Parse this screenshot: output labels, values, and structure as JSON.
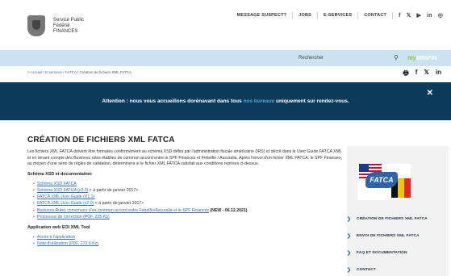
{
  "header": {
    "logo_lines": [
      "Service Public",
      "Fédéral",
      "FINANCES"
    ],
    "topnav": [
      "MESSAGE SUSPECT?",
      "JOBS",
      "E-SERVICES",
      "CONTACT"
    ],
    "social": [
      "f",
      "𝕏",
      "▶",
      "in",
      "◎"
    ]
  },
  "search": {
    "placeholder": "Rechercher",
    "myminfin_my": "my",
    "myminfin_fin": "MINFIN"
  },
  "breadcrumb": {
    "items": [
      "Accueil",
      "E-services",
      "FATCA",
      "Création de fichiers XML FATCA"
    ],
    "separator": "/"
  },
  "share": [
    "🖶",
    "f",
    "𝕏",
    "in"
  ],
  "alert": {
    "part1": "Attention : nous vous accueillons dorénavant dans tous ",
    "highlight": "nos bureaux",
    "part2": " uniquement sur rendez-vous.",
    "close": "✕"
  },
  "main": {
    "title": "CRÉATION DE FICHIERS XML FATCA",
    "intro": "Les fichiers XML FATCA doivent être formatés conformément au schéma XSD défini par l'administration fiscale américaine (IRS) et décrit dans le User Guide FATCA XML et en tenant compte des Business rules établies de commun accord entre le SPF Finances et Febelfin / Assuralia. Après l'envoi d'un fichier XML FATCA, le SPF Finances, au moyen d'une série de règles de validation, déterminera si le fichier XML FATCA satisfait aux conditions reprises ci-dessus.",
    "section1": "Schéma XSD et documentation",
    "links1": [
      {
        "link": "Schéma XSD FATCA",
        "suffix": ""
      },
      {
        "link": "Schéma XSD FATCA (v2.0)",
        "suffix": " < à partir de janvier 2017>"
      },
      {
        "link": "FATCA XML User Guide (V1.1)",
        "suffix": ""
      },
      {
        "link": "FATCA XML User Guide (v2.0)",
        "suffix": " < à partir de janvier 2017>"
      },
      {
        "link": "Business Rules convenues d'un commun accord entre Febelfin/Assuralia et le SPF Finances",
        "suffix": " ",
        "bold": "(NEW - 06.12.2021)"
      },
      {
        "link": "Processus de correction (PDF, 225 Ko)",
        "suffix": ""
      }
    ],
    "section2": "Application web EOI XML Tool",
    "links2": [
      {
        "link": "Accès à l'application",
        "suffix": ""
      },
      {
        "link": "Note d'utilisation (PDF, 273.6 Ko)",
        "suffix": ""
      }
    ]
  },
  "sidebar": {
    "image_label": "FATCA",
    "items": [
      "CRÉATION DE FICHIERS XML FATCA",
      "ENVOI DE FICHIERS XML FATCA",
      "FAQ ET DOCUMENTATION",
      "CONTACT"
    ]
  },
  "colors": {
    "alert_bg": "#0c3a5c",
    "search_bg": "#c9e4f0",
    "link": "#3a6ea5"
  }
}
